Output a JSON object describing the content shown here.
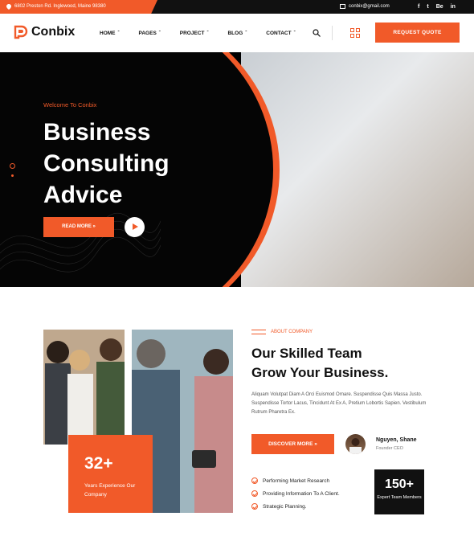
{
  "colors": {
    "accent": "#f15a29",
    "dark": "#111111"
  },
  "topbar": {
    "address": "6802 Preston Rd. Inglewood, Maine 98380",
    "email": "conbix@gmail.com",
    "socials": [
      "f",
      "t",
      "Be",
      "in"
    ],
    "icons": [
      "map-pin-icon",
      "mail-icon",
      "facebook-icon",
      "twitter-icon",
      "behance-icon",
      "instagram-icon"
    ]
  },
  "nav": {
    "brand": "Conbix",
    "menu": [
      "HOME",
      "PAGES",
      "PROJECT",
      "BLOG",
      "CONTACT"
    ],
    "cta": "REQUEST QUOTE"
  },
  "hero": {
    "welcome": "Welcome To Conbix",
    "title_lines": [
      "Business",
      "Consulting",
      "Advice"
    ],
    "read_more": "READ MORE  »"
  },
  "about": {
    "tag": "ABOUT COMPANY",
    "title_line1": "Our Skilled Team",
    "title_line2": "Grow Your Business.",
    "body": "Aliquam Volutpat Diam A Orci Euismod Ornare. Suspendisse Quis Massa Justo. Suspendisse Tortor Lacus, Tincidunt At Ex A, Pretium Lobortis Sapien. Vestibulum Rutrum Pharetra Ex.",
    "discover": "DISCOVER MORE  »",
    "author_name": "Nguyen, Shane",
    "author_role": "Founder CEO",
    "checks": [
      "Performing Market Research",
      "Providing Information To A Client.",
      "Strategic Planning."
    ],
    "experience_number": "32+",
    "experience_label": "Years Experience Our Company",
    "team_number": "150+",
    "team_label": "Expert Team Members"
  }
}
